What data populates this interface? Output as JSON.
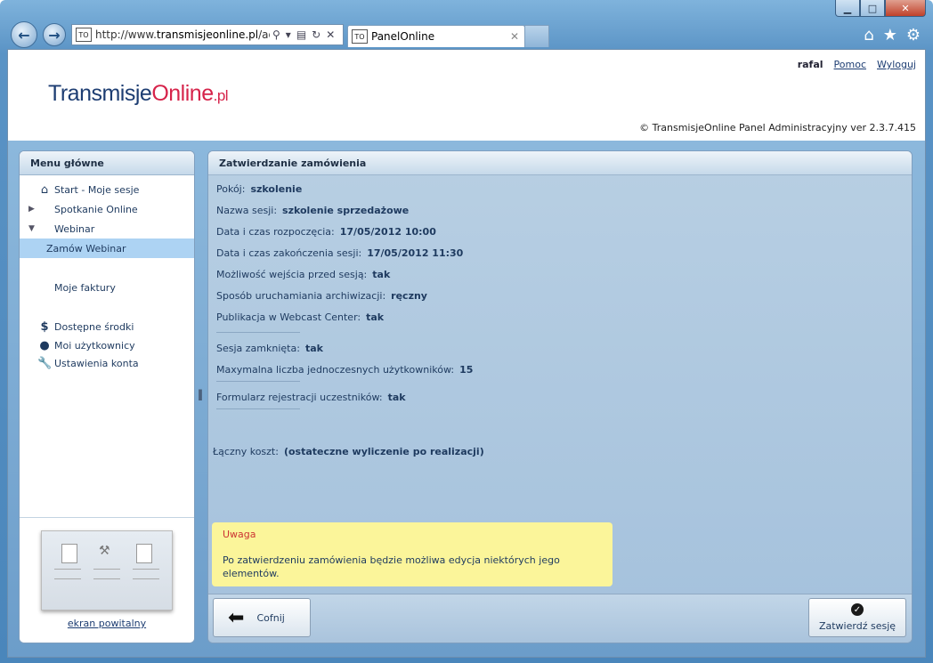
{
  "browser": {
    "url_prefix": "http://www.",
    "url_domain": "transmisjeonline.pl",
    "url_rest": "/adm",
    "favicon_text": "TO",
    "tab_title": "PanelOnline"
  },
  "header": {
    "logo_part1": "Transmisje",
    "logo_part2": "Online",
    "logo_part3": ".pl",
    "username": "rafal",
    "help_link": "Pomoc",
    "logout_link": "Wyloguj",
    "copyright": "© TransmisjeOnline Panel Administracyjny ver 2.3.7.415"
  },
  "sidebar": {
    "title": "Menu główne",
    "items": [
      {
        "label": "Start - Moje sesje"
      },
      {
        "label": "Spotkanie Online"
      },
      {
        "label": "Webinar"
      },
      {
        "label": "Zamów Webinar"
      },
      {
        "label": "Moje faktury"
      },
      {
        "label": "Dostępne środki"
      },
      {
        "label": "Moi użytkownicy"
      },
      {
        "label": "Ustawienia konta"
      }
    ],
    "welcome_link": "ekran powitalny"
  },
  "main": {
    "title": "Zatwierdzanie zamówienia",
    "fields": [
      {
        "label": "Pokój:",
        "value": "szkolenie"
      },
      {
        "label": "Nazwa sesji:",
        "value": "szkolenie sprzedażowe"
      },
      {
        "label": "Data i czas rozpoczęcia:",
        "value": "17/05/2012 10:00"
      },
      {
        "label": "Data i czas zakończenia sesji:",
        "value": "17/05/2012 11:30"
      },
      {
        "label": "Możliwość wejścia przed sesją:",
        "value": "tak"
      },
      {
        "label": "Sposób uruchamiania archiwizacji:",
        "value": "ręczny"
      },
      {
        "label": "Publikacja w Webcast Center:",
        "value": "tak"
      },
      {
        "label": "Sesja zamknięta:",
        "value": "tak"
      },
      {
        "label": "Maxymalna liczba jednoczesnych użytkowników:",
        "value": "15"
      },
      {
        "label": "Formularz rejestracji uczestników:",
        "value": "tak"
      }
    ],
    "total_label": "Łączny koszt:",
    "total_value": "(ostateczne wyliczenie po realizacji)",
    "warning_title": "Uwaga",
    "warning_text": "Po zatwierdzeniu zamówienia będzie możliwa edycja niektórych jego elementów.",
    "back_button": "Cofnij",
    "confirm_button": "Zatwierdź sesję"
  }
}
